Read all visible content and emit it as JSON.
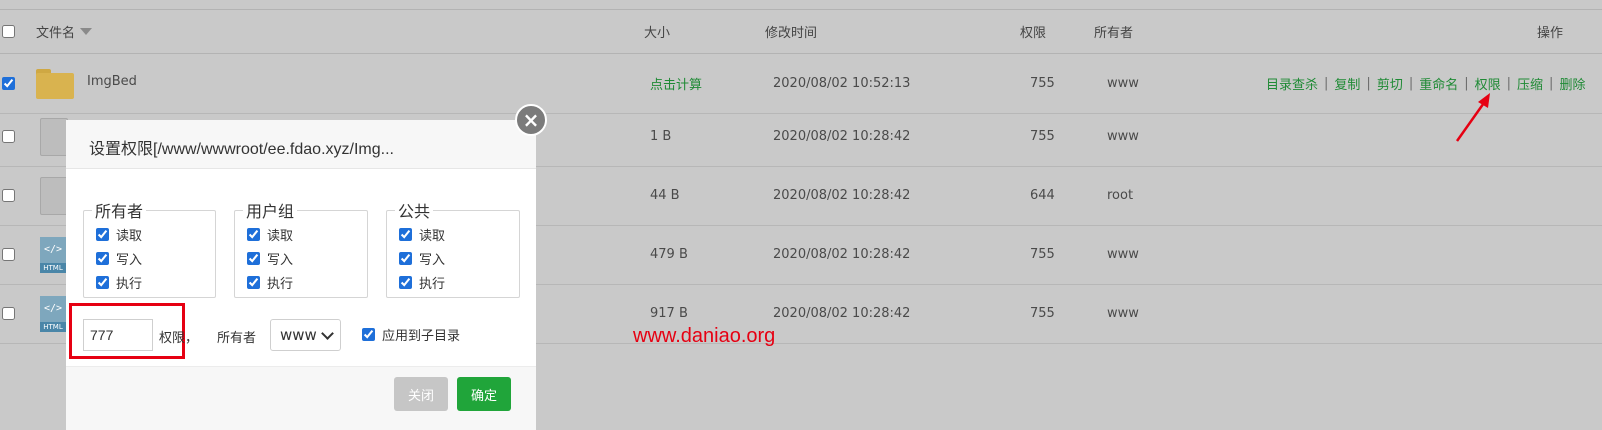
{
  "table": {
    "header": {
      "name": "文件名",
      "size": "大小",
      "mtime": "修改时间",
      "perm": "权限",
      "owner": "所有者",
      "ops": "操作"
    },
    "rows": [
      {
        "name": "ImgBed",
        "size": "点击计算",
        "mtime": "2020/08/02 10:52:13",
        "perm": "755",
        "owner": "www",
        "checked": true
      },
      {
        "name": "",
        "size": "1 B",
        "mtime": "2020/08/02 10:28:42",
        "perm": "755",
        "owner": "www",
        "checked": false
      },
      {
        "name": "",
        "size": "44 B",
        "mtime": "2020/08/02 10:28:42",
        "perm": "644",
        "owner": "root",
        "checked": false
      },
      {
        "name": "",
        "size": "479 B",
        "mtime": "2020/08/02 10:28:42",
        "perm": "755",
        "owner": "www",
        "checked": false
      },
      {
        "name": "",
        "size": "917 B",
        "mtime": "2020/08/02 10:28:42",
        "perm": "755",
        "owner": "www",
        "checked": false
      }
    ],
    "row_actions": [
      "目录查杀",
      "复制",
      "剪切",
      "重命名",
      "权限",
      "压缩",
      "删除"
    ],
    "html_icon_label": "HTML",
    "html_icon_glyph": "</>"
  },
  "watermark": "www.daniao.org",
  "dialog": {
    "title": "设置权限[/www/wwwroot/ee.fdao.xyz/Img...",
    "close_glyph": "×",
    "groups": [
      {
        "legend": "所有者",
        "perms": [
          "读取",
          "写入",
          "执行"
        ]
      },
      {
        "legend": "用户组",
        "perms": [
          "读取",
          "写入",
          "执行"
        ]
      },
      {
        "legend": "公共",
        "perms": [
          "读取",
          "写入",
          "执行"
        ]
      }
    ],
    "mode_value": "777",
    "mode_label": "权限，",
    "owner_label": "所有者",
    "owner_value": "www",
    "apply_sub": "应用到子目录",
    "btn_close": "关闭",
    "btn_ok": "确定"
  },
  "colors": {
    "action_green": "#1f8a35",
    "ok_button": "#20a53a",
    "highlight_red": "#e60012"
  }
}
